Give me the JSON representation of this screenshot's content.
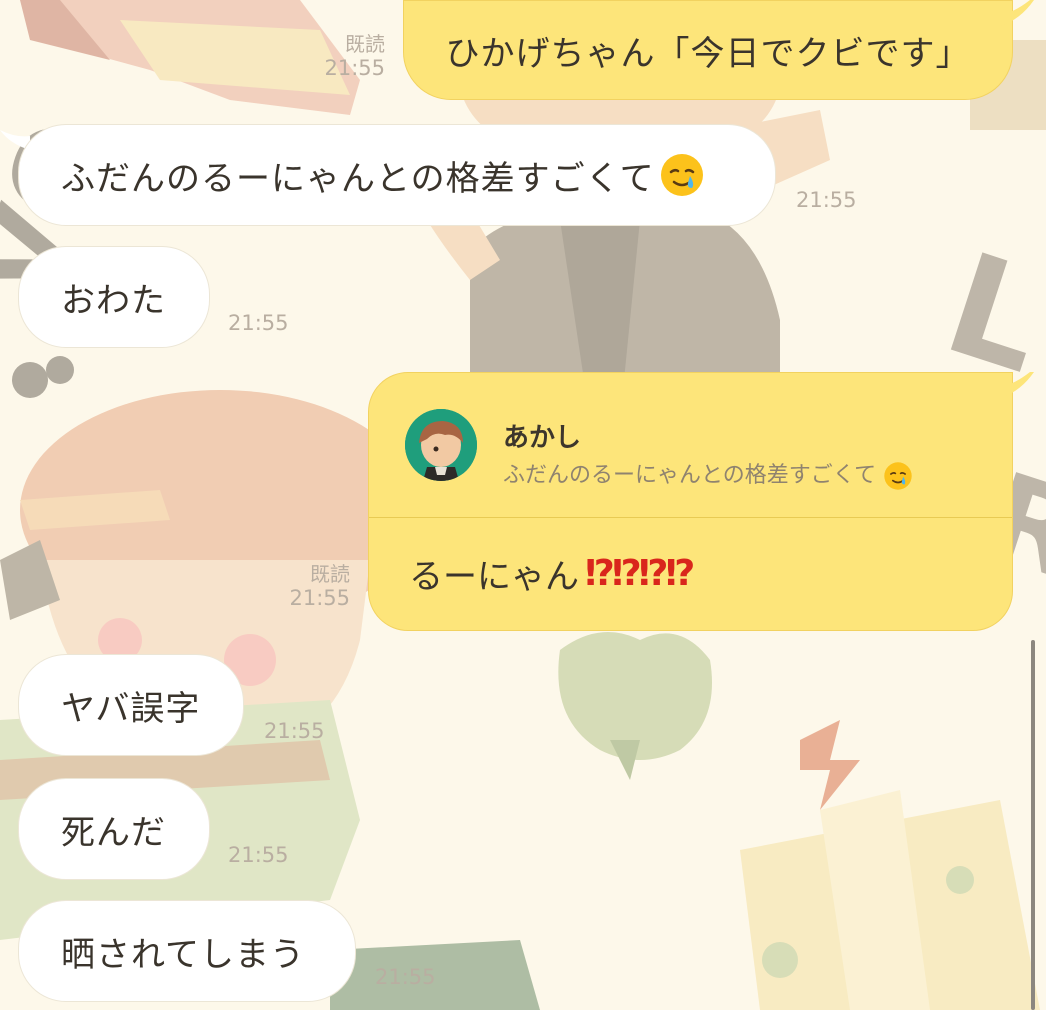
{
  "chat": {
    "messages": [
      {
        "side": "out",
        "text": "ひかげちゃん「今日でクビです」",
        "read_label": "既読",
        "time": "21:55"
      },
      {
        "side": "in",
        "text": "ふだんのるーにゃんとの格差すごくて",
        "emoji": "sad-relieved-face",
        "time": "21:55"
      },
      {
        "side": "in",
        "text": "おわた",
        "time": "21:55"
      },
      {
        "side": "out",
        "type": "reply",
        "quoted_name": "あかし",
        "quoted_text": "ふだんのるーにゃんとの格差すごくて",
        "quoted_emoji": "sad-relieved-face",
        "text": "るーにゃん",
        "marks": "⁉⁉⁉⁉",
        "read_label": "既読",
        "time": "21:55"
      },
      {
        "side": "in",
        "text": "ヤバ誤字",
        "time": "21:55"
      },
      {
        "side": "in",
        "text": "死んだ",
        "time": "21:55"
      },
      {
        "side": "in",
        "text": "晒されてしまう",
        "time": "21:55"
      }
    ]
  },
  "colors": {
    "outgoing_bubble": "#fde57a",
    "incoming_bubble": "#ffffff",
    "background": "#fdf8ea",
    "exclamation": "#d9261c",
    "avatar_bg": "#1f9e7c"
  }
}
